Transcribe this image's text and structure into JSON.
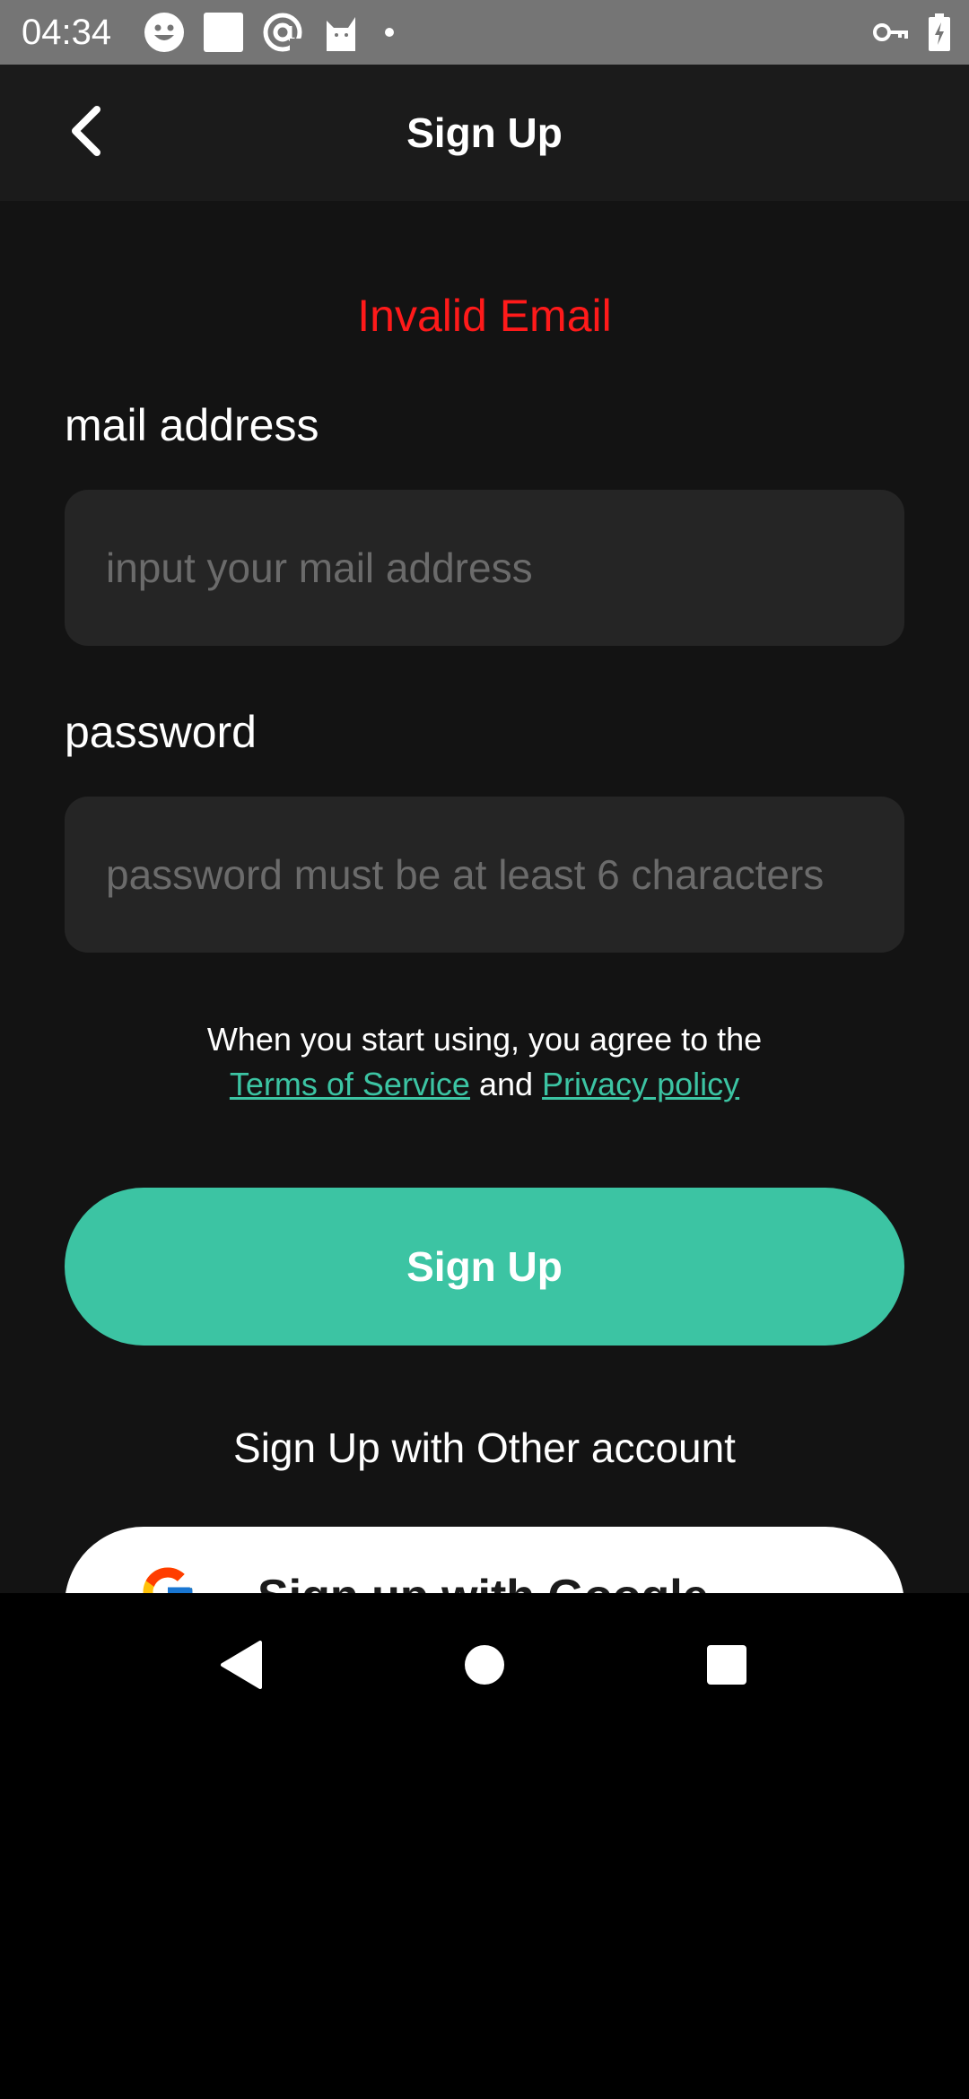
{
  "status_bar": {
    "time": "04:34",
    "left_icons": [
      "smiley-icon",
      "square-icon",
      "at-icon",
      "cat-icon",
      "dot-icon"
    ],
    "right_icons": [
      "key-icon",
      "battery-icon"
    ]
  },
  "app_bar": {
    "title": "Sign Up",
    "back_icon": "chevron-left-icon"
  },
  "form": {
    "error_message": "Invalid Email",
    "email_label": "mail address",
    "email_placeholder": "input your mail address",
    "email_value": "",
    "password_label": "password",
    "password_placeholder": "password must be at least 6 characters",
    "password_value": ""
  },
  "terms": {
    "line1": "When you start using, you agree to the",
    "terms_link": "Terms of Service",
    "and_text": " and ",
    "privacy_link": "Privacy policy"
  },
  "signup_button": "Sign Up",
  "other_account_label": "Sign Up with Other account",
  "google_button": "Sign up with Google",
  "nav_bar": [
    "back-triangle-icon",
    "home-circle-icon",
    "recents-square-icon"
  ],
  "colors": {
    "accent": "#3cc4a3",
    "error": "#ff1a1a",
    "background": "#131313",
    "input_background": "#252525",
    "app_bar": "#1b1b1b",
    "status_bar": "#757575"
  }
}
